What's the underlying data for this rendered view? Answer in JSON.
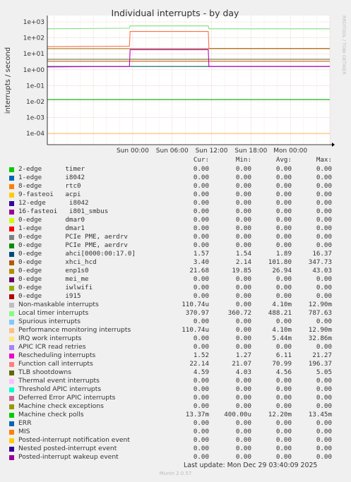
{
  "chart_data": {
    "type": "line",
    "title": "Individual interrupts - by day",
    "ylabel": "interrupts / second",
    "yscale": "log",
    "ylim": [
      5e-05,
      3000
    ],
    "y_ticks": [
      "1e+03",
      "1e+02",
      "1e+01",
      "1e+00",
      "1e-01",
      "1e-02",
      "1e-03",
      "1e-04"
    ],
    "x_ticks": [
      "Sun 00:00",
      "Sun 06:00",
      "Sun 12:00",
      "Sun 18:00",
      "Mon 00:00"
    ],
    "xlim_hours": [
      -13,
      30
    ],
    "grid": true,
    "watermark": "RRDTOOL / TOBI OETIKER",
    "series": [
      {
        "name": "Local timer interrupts",
        "color": "#7ede7e",
        "values": [
          [
            -13,
            370
          ],
          [
            -0.5,
            400
          ],
          [
            -0.4,
            560
          ],
          [
            11.5,
            560
          ],
          [
            11.6,
            370
          ],
          [
            30,
            370
          ]
        ]
      },
      {
        "name": "Function call interrupts",
        "color": "#ff6f40",
        "values": [
          [
            -13,
            28
          ],
          [
            -0.5,
            30
          ],
          [
            -0.4,
            250
          ],
          [
            11.5,
            250
          ],
          [
            11.6,
            22
          ],
          [
            30,
            22
          ]
        ]
      },
      {
        "name": "ahci[0000:00:17.0]",
        "color": "#0a5f5f",
        "values": [
          [
            -13,
            1.6
          ],
          [
            30,
            1.6
          ]
        ]
      },
      {
        "name": "xhci_hcd",
        "color": "#c06018",
        "values": [
          [
            -13,
            3.4
          ],
          [
            30,
            3.4
          ]
        ]
      },
      {
        "name": "enp1s0",
        "color": "#a07818",
        "values": [
          [
            -13,
            21
          ],
          [
            30,
            21
          ]
        ]
      },
      {
        "name": "Rescheduling interrupts",
        "color": "#c000c0",
        "values": [
          [
            -13,
            1.5
          ],
          [
            -0.5,
            1.6
          ],
          [
            -0.4,
            18
          ],
          [
            11.5,
            18
          ],
          [
            11.6,
            1.6
          ],
          [
            30,
            1.6
          ]
        ]
      },
      {
        "name": "TLB shootdowns",
        "color": "#606020",
        "values": [
          [
            -13,
            4.5
          ],
          [
            30,
            4.5
          ]
        ]
      },
      {
        "name": "Machine check polls",
        "color": "#00aa00",
        "values": [
          [
            -13,
            0.0134
          ],
          [
            30,
            0.0134
          ]
        ]
      },
      {
        "name": "Performance monitoring interrupts",
        "color": "#ffbb66",
        "values": [
          [
            -13,
            0.0001
          ],
          [
            30,
            0.0001
          ]
        ]
      }
    ]
  },
  "legend": {
    "headers": {
      "cur": "Cur:",
      "min": "Min:",
      "avg": "Avg:",
      "max": "Max:"
    },
    "rows": [
      {
        "label": "2-edge      timer",
        "mono": true,
        "color": "#00cc00",
        "cur": "0.00",
        "min": "0.00",
        "avg": "0.00",
        "max": "0.00"
      },
      {
        "label": "1-edge      i8042",
        "mono": true,
        "color": "#0066b3",
        "cur": "0.00",
        "min": "0.00",
        "avg": "0.00",
        "max": "0.00"
      },
      {
        "label": "8-edge      rtc0",
        "mono": true,
        "color": "#ff8000",
        "cur": "0.00",
        "min": "0.00",
        "avg": "0.00",
        "max": "0.00"
      },
      {
        "label": "9-fasteoi   acpi",
        "mono": true,
        "color": "#ffcc00",
        "cur": "0.00",
        "min": "0.00",
        "avg": "0.00",
        "max": "0.00"
      },
      {
        "label": "12-edge      i8042",
        "mono": true,
        "color": "#330099",
        "cur": "0.00",
        "min": "0.00",
        "avg": "0.00",
        "max": "0.00"
      },
      {
        "label": "16-fasteoi   i801_smbus",
        "mono": true,
        "color": "#990099",
        "cur": "0.00",
        "min": "0.00",
        "avg": "0.00",
        "max": "0.00"
      },
      {
        "label": "0-edge      dmar0",
        "mono": true,
        "color": "#ccff00",
        "cur": "0.00",
        "min": "0.00",
        "avg": "0.00",
        "max": "0.00"
      },
      {
        "label": "1-edge      dmar1",
        "mono": true,
        "color": "#ff0000",
        "cur": "0.00",
        "min": "0.00",
        "avg": "0.00",
        "max": "0.00"
      },
      {
        "label": "0-edge      PCIe PME, aerdrv",
        "mono": true,
        "color": "#808080",
        "cur": "0.00",
        "min": "0.00",
        "avg": "0.00",
        "max": "0.00"
      },
      {
        "label": "0-edge      PCIe PME, aerdrv",
        "mono": true,
        "color": "#008f00",
        "cur": "0.00",
        "min": "0.00",
        "avg": "0.00",
        "max": "0.00"
      },
      {
        "label": "0-edge      ahci[0000:00:17.0]",
        "mono": true,
        "color": "#00487d",
        "cur": "1.57",
        "min": "1.54",
        "avg": "1.89",
        "max": "16.37"
      },
      {
        "label": "0-edge      xhci_hcd",
        "mono": true,
        "color": "#b35a00",
        "cur": "3.40",
        "min": "2.14",
        "avg": "101.80",
        "max": "347.73"
      },
      {
        "label": "0-edge      enp1s0",
        "mono": true,
        "color": "#b38f00",
        "cur": "21.68",
        "min": "19.85",
        "avg": "26.94",
        "max": "43.03"
      },
      {
        "label": "0-edge      mei_me",
        "mono": true,
        "color": "#6b006b",
        "cur": "0.00",
        "min": "0.00",
        "avg": "0.00",
        "max": "0.00"
      },
      {
        "label": "0-edge      iwlwifi",
        "mono": true,
        "color": "#8fb300",
        "cur": "0.00",
        "min": "0.00",
        "avg": "0.00",
        "max": "0.00"
      },
      {
        "label": "0-edge      i915",
        "mono": true,
        "color": "#b30000",
        "cur": "0.00",
        "min": "0.00",
        "avg": "0.00",
        "max": "0.00"
      },
      {
        "label": "Non-maskable interrupts",
        "mono": false,
        "color": "#bebebe",
        "cur": "110.74u",
        "min": "0.00",
        "avg": "4.10m",
        "max": "12.90m"
      },
      {
        "label": "Local timer interrupts",
        "mono": false,
        "color": "#80ff80",
        "cur": "370.97",
        "min": "360.72",
        "avg": "488.21",
        "max": "787.63"
      },
      {
        "label": "Spurious interrupts",
        "mono": false,
        "color": "#80c9ff",
        "cur": "0.00",
        "min": "0.00",
        "avg": "0.00",
        "max": "0.00"
      },
      {
        "label": "Performance monitoring interrupts",
        "mono": false,
        "color": "#ffc080",
        "cur": "110.74u",
        "min": "0.00",
        "avg": "4.10m",
        "max": "12.90m"
      },
      {
        "label": "IRQ work interrupts",
        "mono": false,
        "color": "#ffe680",
        "cur": "0.00",
        "min": "0.00",
        "avg": "5.44m",
        "max": "32.86m"
      },
      {
        "label": "APIC ICR read retries",
        "mono": false,
        "color": "#aa80ff",
        "cur": "0.00",
        "min": "0.00",
        "avg": "0.00",
        "max": "0.00"
      },
      {
        "label": "Rescheduling interrupts",
        "mono": false,
        "color": "#ee00cc",
        "cur": "1.52",
        "min": "1.27",
        "avg": "6.11",
        "max": "21.27"
      },
      {
        "label": "Function call interrupts",
        "mono": false,
        "color": "#ff8080",
        "cur": "22.14",
        "min": "21.07",
        "avg": "70.99",
        "max": "196.37"
      },
      {
        "label": "TLB shootdowns",
        "mono": false,
        "color": "#666600",
        "cur": "4.59",
        "min": "4.03",
        "avg": "4.56",
        "max": "5.05"
      },
      {
        "label": "Thermal event interrupts",
        "mono": false,
        "color": "#ffbfff",
        "cur": "0.00",
        "min": "0.00",
        "avg": "0.00",
        "max": "0.00"
      },
      {
        "label": "Threshold APIC interrupts",
        "mono": false,
        "color": "#00ffcc",
        "cur": "0.00",
        "min": "0.00",
        "avg": "0.00",
        "max": "0.00"
      },
      {
        "label": "Deferred Error APIC interrupts",
        "mono": false,
        "color": "#cc6699",
        "cur": "0.00",
        "min": "0.00",
        "avg": "0.00",
        "max": "0.00"
      },
      {
        "label": "Machine check exceptions",
        "mono": false,
        "color": "#999900",
        "cur": "0.00",
        "min": "0.00",
        "avg": "0.00",
        "max": "0.00"
      },
      {
        "label": "Machine check polls",
        "mono": false,
        "color": "#00cc00",
        "cur": "13.37m",
        "min": "400.00u",
        "avg": "12.20m",
        "max": "13.45m"
      },
      {
        "label": "ERR",
        "mono": false,
        "color": "#0066b3",
        "cur": "0.00",
        "min": "0.00",
        "avg": "0.00",
        "max": "0.00"
      },
      {
        "label": "MIS",
        "mono": false,
        "color": "#ff8000",
        "cur": "0.00",
        "min": "0.00",
        "avg": "0.00",
        "max": "0.00"
      },
      {
        "label": "Posted-interrupt notification event",
        "mono": false,
        "color": "#ffcc00",
        "cur": "0.00",
        "min": "0.00",
        "avg": "0.00",
        "max": "0.00"
      },
      {
        "label": "Nested posted-interrupt event",
        "mono": false,
        "color": "#330099",
        "cur": "0.00",
        "min": "0.00",
        "avg": "0.00",
        "max": "0.00"
      },
      {
        "label": "Posted-interrupt wakeup event",
        "mono": false,
        "color": "#990099",
        "cur": "0.00",
        "min": "0.00",
        "avg": "0.00",
        "max": "0.00"
      }
    ]
  },
  "footer": {
    "last_update": "Last update: Mon Dec 29 03:40:09 2025",
    "munin": "Munin 2.0.57"
  }
}
